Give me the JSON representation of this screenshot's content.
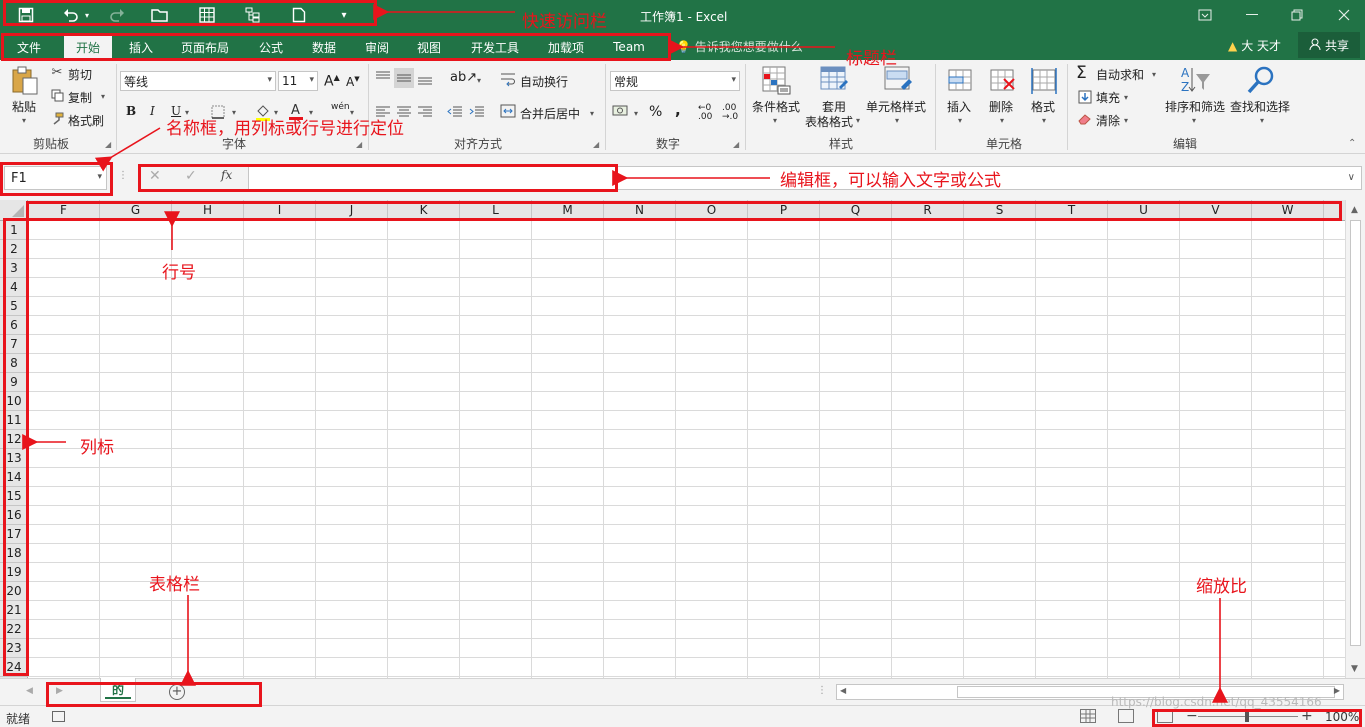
{
  "window": {
    "title": "工作簿1 - Excel"
  },
  "qat": {
    "save": "save-icon",
    "undo": "undo-icon",
    "redo": "redo-icon",
    "open": "open-folder-icon",
    "table": "table-icon",
    "tree": "tree-icon",
    "new": "new-document-icon",
    "customize": "▾"
  },
  "tabs": [
    "文件",
    "开始",
    "插入",
    "页面布局",
    "公式",
    "数据",
    "审阅",
    "视图",
    "开发工具",
    "加载项",
    "Team"
  ],
  "active_tab": "开始",
  "tellme": "告诉我您想要做什么",
  "user": {
    "name": "大 天才",
    "share": "共享"
  },
  "ribbon": {
    "clipboard": {
      "paste": "粘贴",
      "cut": "剪切",
      "copy": "复制",
      "format_painter": "格式刷",
      "label": "剪贴板"
    },
    "font": {
      "name": "等线",
      "size": "11",
      "label": "字体",
      "wen": "wén"
    },
    "alignment": {
      "wrap": "自动换行",
      "merge": "合并后居中",
      "label": "对齐方式"
    },
    "number": {
      "format": "常规",
      "label": "数字",
      "percent": "%",
      "comma": ","
    },
    "styles": {
      "conditional": "条件格式",
      "table_line1": "套用",
      "table_line2": "表格格式",
      "cell_styles": "单元格样式",
      "label": "样式"
    },
    "cells": {
      "insert": "插入",
      "delete": "删除",
      "format": "格式",
      "label": "单元格"
    },
    "editing": {
      "autosum": "自动求和",
      "fill": "填充",
      "clear": "清除",
      "sort": "排序和筛选",
      "find": "查找和选择",
      "label": "编辑"
    }
  },
  "formula_bar": {
    "name_box": "F1",
    "fx": "fx",
    "cancel": "✕",
    "enter": "✓",
    "value": ""
  },
  "columns": [
    "F",
    "G",
    "H",
    "I",
    "J",
    "K",
    "L",
    "M",
    "N",
    "O",
    "P",
    "Q",
    "R",
    "S",
    "T",
    "U",
    "V",
    "W"
  ],
  "rows": [
    "1",
    "2",
    "3",
    "4",
    "5",
    "6",
    "7",
    "8",
    "9",
    "10",
    "11",
    "12",
    "13",
    "14",
    "15",
    "16",
    "17",
    "18",
    "19",
    "20",
    "21",
    "22",
    "23",
    "24"
  ],
  "sheets": [
    "的"
  ],
  "status": {
    "ready": "就绪",
    "zoom": "100%"
  },
  "watermark": "https://blog.csdn.net/qq_43554166",
  "annotations": {
    "qat": "快速访问栏",
    "title_bar": "标题栏",
    "name_box": "名称框，用列标或行号进行定位",
    "edit_box": "编辑框，可以输入文字或公式",
    "row_number": "行号",
    "column_label": "列标",
    "sheet_bar": "表格栏",
    "zoom": "缩放比"
  },
  "colors": {
    "excel_green": "#217346",
    "annotation_red": "#e8141c"
  }
}
